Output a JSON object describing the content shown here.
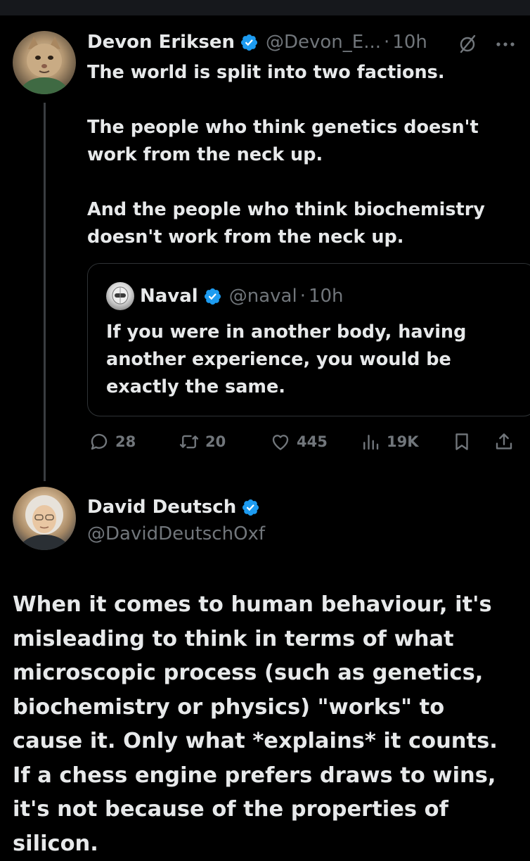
{
  "colors": {
    "background": "#000000",
    "text": "#e7e9ea",
    "muted": "#71767b",
    "verified": "#1d9bf0",
    "border": "#2f3336",
    "thread_line": "#3a3d41"
  },
  "tweet1": {
    "avatar_icon": "cat-avatar",
    "name": "Devon Eriksen",
    "handle": "@Devon_E...",
    "dot": "·",
    "time": "10h",
    "grok_icon": "grok-icon",
    "more_icon": "more-icon",
    "paragraphs": [
      "The world is split into two factions.",
      "The people who think genetics doesn't work from the neck up.",
      "And the people who think biochemistry doesn't work from the neck up."
    ],
    "quote": {
      "avatar_icon": "robot-avatar",
      "name": "Naval",
      "handle": "@naval",
      "dot": "·",
      "time": "10h",
      "text": "If you were in another body, having another experience, you would be exactly the same."
    },
    "actions": {
      "replies": "28",
      "reposts": "20",
      "likes": "445",
      "views": "19K"
    }
  },
  "tweet2": {
    "avatar_icon": "person-avatar",
    "name": "David Deutsch",
    "handle": "@DavidDeutschOxf",
    "text": "When it comes to human behaviour, it's misleading to think in terms of what microscopic process (such as genetics, biochemistry or physics) \"works\" to cause it. Only what *explains* it counts. If a chess engine prefers draws to wins, it's not because of the properties of silicon."
  }
}
